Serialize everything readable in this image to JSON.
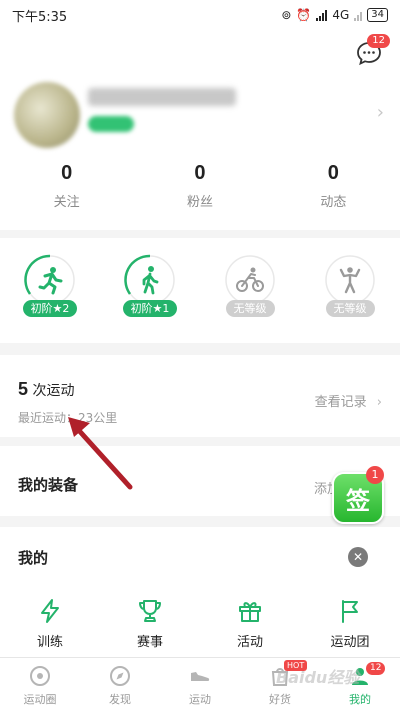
{
  "status_bar": {
    "time": "下午5:35",
    "network": "4G",
    "battery": "34"
  },
  "profile": {
    "message_badge": "12",
    "stats": [
      {
        "value": "0",
        "label": "关注"
      },
      {
        "value": "0",
        "label": "粉丝"
      },
      {
        "value": "0",
        "label": "动态"
      }
    ]
  },
  "levels": [
    {
      "icon": "running-icon",
      "badge": "初阶★2",
      "active": true
    },
    {
      "icon": "walking-icon",
      "badge": "初阶★1",
      "active": true
    },
    {
      "icon": "cycling-icon",
      "badge": "无等级",
      "active": false
    },
    {
      "icon": "fitness-icon",
      "badge": "无等级",
      "active": false
    }
  ],
  "records": {
    "count": "5",
    "count_suffix": "次运动",
    "subtitle": "最近运动：23公里",
    "link": "查看记录"
  },
  "equipment": {
    "title": "我的装备",
    "add_text": "添加",
    "sign_in_label": "签",
    "sign_in_badge": "1"
  },
  "mine": {
    "title": "我的",
    "items": [
      {
        "icon": "lightning-icon",
        "label": "训练"
      },
      {
        "icon": "trophy-icon",
        "label": "赛事"
      },
      {
        "icon": "gift-icon",
        "label": "活动"
      },
      {
        "icon": "flag-icon",
        "label": "运动团"
      }
    ]
  },
  "tabbar": {
    "items": [
      {
        "icon": "circle-target-icon",
        "label": "运动圈"
      },
      {
        "icon": "compass-icon",
        "label": "发现"
      },
      {
        "icon": "shoe-icon",
        "label": "运动"
      },
      {
        "icon": "bag-icon",
        "label": "好货",
        "tag": "HOT"
      },
      {
        "icon": "person-icon",
        "label": "我的",
        "badge": "12",
        "active": true
      }
    ]
  },
  "colors": {
    "accent": "#24b36b",
    "badge": "#f04848",
    "arrow": "#b0202a"
  },
  "watermark": "Baidu经验"
}
